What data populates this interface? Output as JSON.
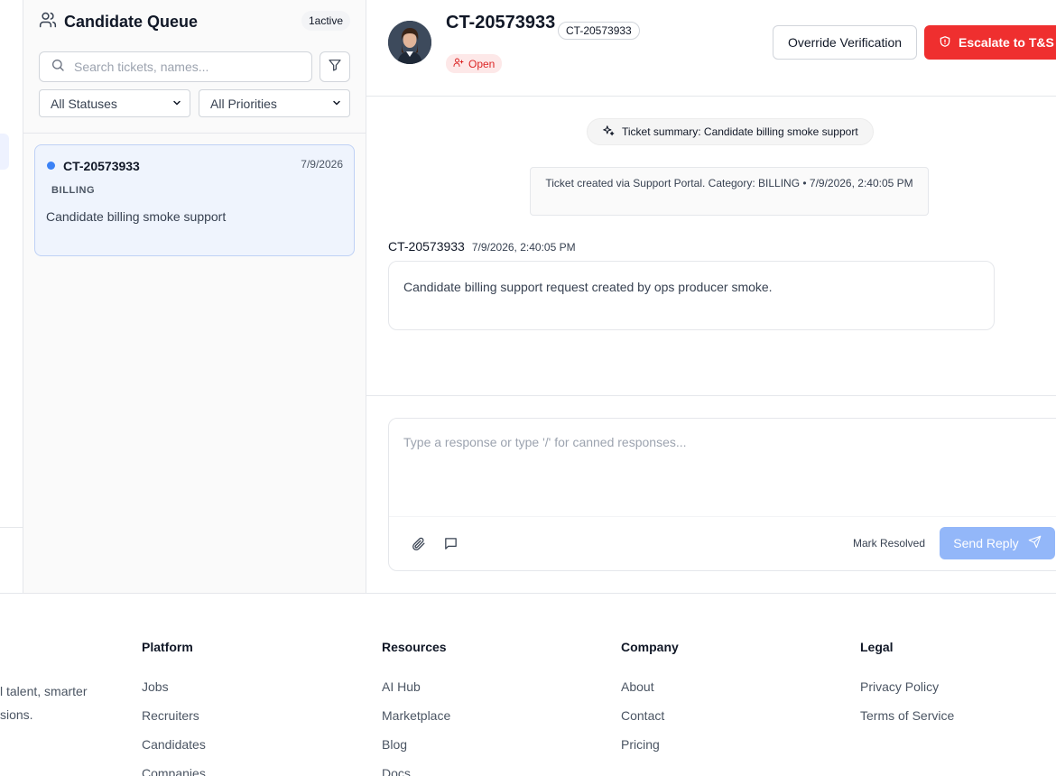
{
  "queue": {
    "title": "Candidate Queue",
    "active_badge": "1active",
    "search_placeholder": "Search tickets, names...",
    "status_filter": "All Statuses",
    "priority_filter": "All Priorities",
    "tickets": [
      {
        "id": "CT-20573933",
        "date": "7/9/2026",
        "category": "BILLING",
        "subject": "Candidate billing smoke support",
        "unread_color": "#3b82f6"
      }
    ]
  },
  "ticket": {
    "id": "CT-20573933",
    "chip": "CT-20573933",
    "status": "Open",
    "override_label": "Override Verification",
    "escalate_label": "Escalate to T&S",
    "summary": "Ticket summary: Candidate billing smoke support",
    "system_message": "Ticket created via Support Portal. Category: BILLING • 7/9/2026, 2:40:05 PM",
    "messages": [
      {
        "author": "CT-20573933",
        "timestamp": "7/9/2026, 2:40:05 PM",
        "body": "Candidate billing support request created by ops producer smoke."
      }
    ]
  },
  "composer": {
    "placeholder": "Type a response or type '/' for canned responses...",
    "mark_resolved": "Mark Resolved",
    "send_label": "Send Reply"
  },
  "footer": {
    "tagline": "l talent, smarter sions.",
    "columns": [
      {
        "title": "Platform",
        "links": [
          "Jobs",
          "Recruiters",
          "Candidates",
          "Companies"
        ]
      },
      {
        "title": "Resources",
        "links": [
          "AI Hub",
          "Marketplace",
          "Blog",
          "Docs"
        ]
      },
      {
        "title": "Company",
        "links": [
          "About",
          "Contact",
          "Pricing"
        ]
      },
      {
        "title": "Legal",
        "links": [
          "Privacy Policy",
          "Terms of Service"
        ]
      }
    ]
  },
  "colors": {
    "accent": "#3b82f6",
    "danger": "#ef2f2f",
    "status_open_bg": "#fde8e8",
    "send_disabled": "#93b7f9"
  }
}
